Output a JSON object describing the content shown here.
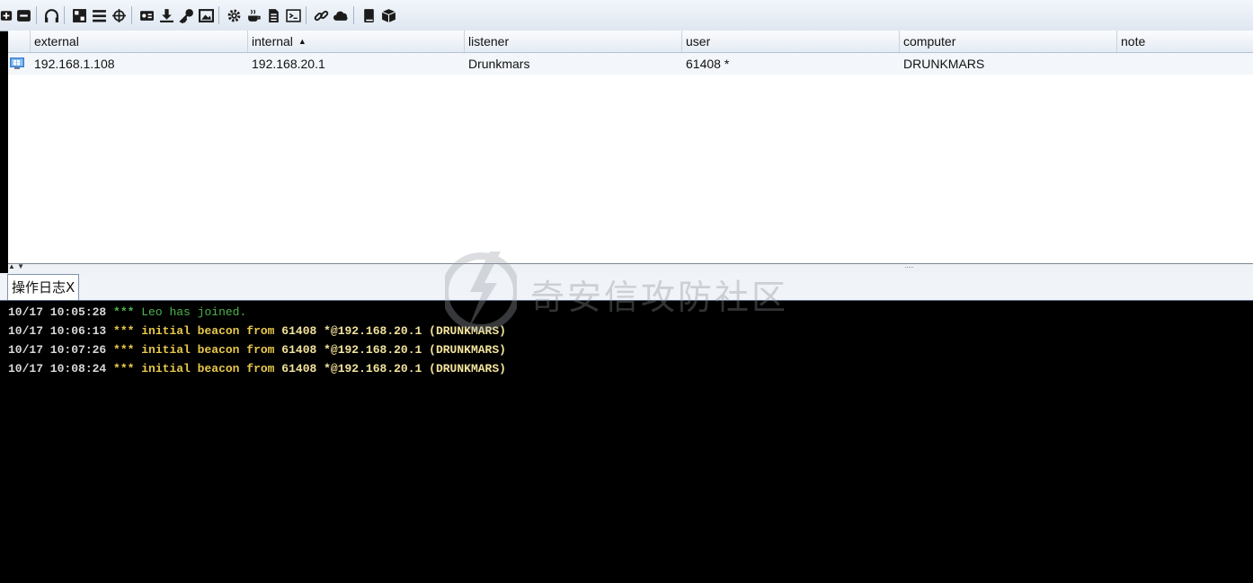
{
  "toolbar": {
    "icons": [
      "plus-box-icon",
      "minus-box-icon",
      "headphones-icon",
      "targets-icon",
      "list-icon",
      "crosshair-icon",
      "credentials-icon",
      "download-icon",
      "key-icon",
      "screenshot-icon",
      "settings-icon",
      "coffee-icon",
      "document-icon",
      "terminal-icon",
      "link-icon",
      "cloud-icon",
      "book-icon",
      "package-icon"
    ]
  },
  "table": {
    "columns": {
      "external": "external",
      "internal": "internal",
      "listener": "listener",
      "user": "user",
      "computer": "computer",
      "note": "note"
    },
    "sort_indicator": "▲",
    "rows": [
      {
        "external": "192.168.1.108",
        "internal": "192.168.20.1",
        "listener": "Drunkmars",
        "user": "61408 *",
        "computer": "DRUNKMARS",
        "note": ""
      }
    ]
  },
  "tabs": {
    "event_log": "操作日志X"
  },
  "console": {
    "lines": [
      {
        "time": "10/17 10:05:28",
        "stars": "***",
        "message": "Leo has joined."
      },
      {
        "time": "10/17 10:06:13",
        "stars": "***",
        "message": "initial beacon from",
        "user": "61408 *@192.168.20.1",
        "host": "(DRUNKMARS)"
      },
      {
        "time": "10/17 10:07:26",
        "stars": "***",
        "message": "initial beacon from",
        "user": "61408 *@192.168.20.1",
        "host": "(DRUNKMARS)"
      },
      {
        "time": "10/17 10:08:24",
        "stars": "***",
        "message": "initial beacon from",
        "user": "61408 *@192.168.20.1",
        "host": "(DRUNKMARS)"
      }
    ]
  },
  "watermark": {
    "text": "奇安信攻防社区"
  },
  "colors": {
    "join_green": "#4db34d",
    "beacon_yellow": "#e8c84a",
    "console_bg": "#000000"
  }
}
